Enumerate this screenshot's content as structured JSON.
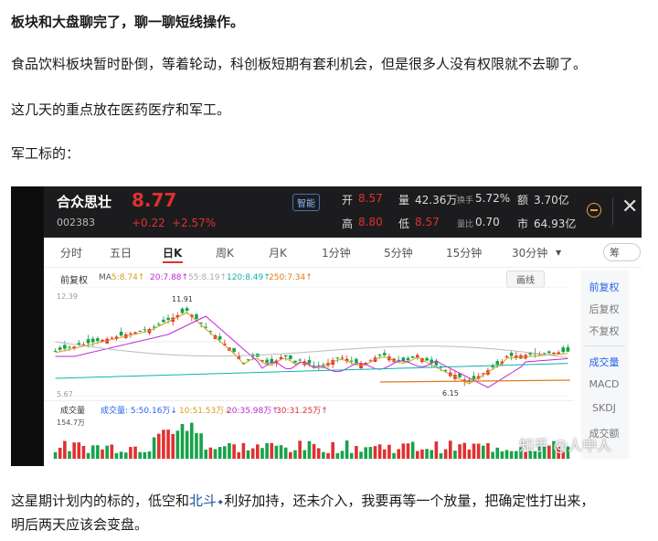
{
  "article": {
    "heading": "板块和大盘聊完了，聊一聊短线操作。",
    "p1": "食品饮料板块暂时卧倒，等着轮动，科创板短期有套利机会，但是很多人没有权限就不去聊了。",
    "p2": "这几天的重点放在医药医疗和军工。",
    "p3": "军工标的：",
    "p4_pre": "这星期计划内的标的，低空和",
    "p4_link": "北斗",
    "p4_post": "利好加持，还未介入，我要再等一个放量，把确定性打出来，",
    "p5": "明后两天应该会变盘。"
  },
  "stock": {
    "name": "合众思壮",
    "code": "002383",
    "price": "8.77",
    "change": "+0.22",
    "change_pct": "+2.57%",
    "badge": "智能",
    "open_label": "开",
    "open": "8.57",
    "high_label": "高",
    "high": "8.80",
    "low_label": "低",
    "low": "8.57",
    "vol_label": "量",
    "vol": "42.36万",
    "turnover_label": "换手",
    "turnover": "5.72%",
    "ratio_label": "量比",
    "ratio": "0.70",
    "amount_label": "额",
    "amount": "3.70亿",
    "mcap_label": "市",
    "mcap": "64.93亿",
    "close_icon": "close-icon",
    "colors": {
      "up": "#e03030",
      "down": "#16a34a",
      "header_bg": "#1c1c1e"
    }
  },
  "tabs": [
    "分时",
    "五日",
    "日K",
    "周K",
    "月K",
    "1分钟",
    "5分钟",
    "15分钟",
    "30分钟"
  ],
  "active_tab": "日K",
  "toolbar": {
    "adjust": "前复权",
    "ma": "MA",
    "ma5": "5:8.74↑",
    "ma10": "20:7.88↑",
    "ma20": "55:8.19↑",
    "ma60": "120:8.49↑",
    "ma250": "250:7.34↑",
    "draw": "画线",
    "side_toggle": "筹"
  },
  "price_panel": {
    "top_label": "12.39",
    "bottom_label": "5.67",
    "high_mark": "11.91",
    "low_mark": "6.15"
  },
  "volume_panel": {
    "label": "成交量",
    "v1": "成交量: 5:50.16万↓",
    "v2": "10:51.53万↓",
    "v3": "20:35.98万↑",
    "v4": "30:31.25万↑",
    "max": "154.7万"
  },
  "right_menu": [
    "前复权",
    "后复权",
    "不复权",
    "成交量",
    "MACD",
    "SKDJ",
    "成交额"
  ],
  "watermark": "知乎 @人中人"
}
